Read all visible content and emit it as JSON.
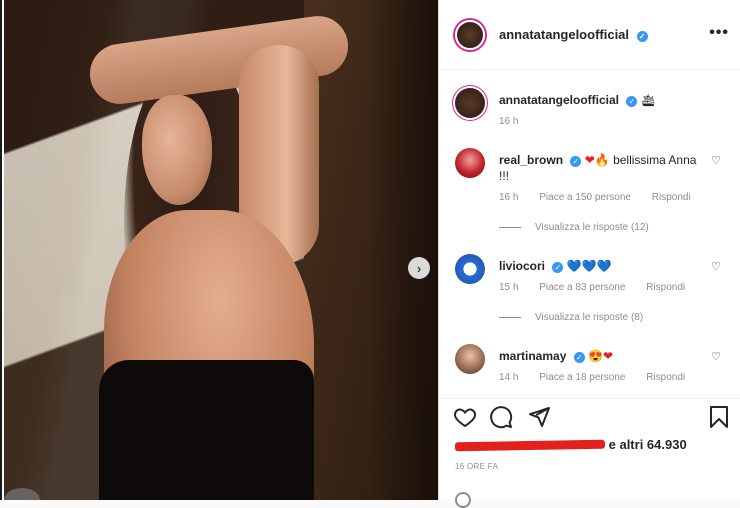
{
  "post": {
    "username": "annatatangeloofficial",
    "more_label": "•••"
  },
  "caption": {
    "username": "annatatangeloofficial",
    "emoji": "🛳",
    "time": "16 h"
  },
  "comments": [
    {
      "username": "real_brown",
      "text_emoji": "❤🔥",
      "text": "bellissima Anna !!!",
      "time": "16 h",
      "likes": "Piace a 150 persone",
      "reply": "Rispondi",
      "view_replies": "Visualizza le risposte (12)"
    },
    {
      "username": "liviocori",
      "text_emoji": "💙💙💙",
      "text": "",
      "time": "15 h",
      "likes": "Piace a 83 persone",
      "reply": "Rispondi",
      "view_replies": "Visualizza le risposte (8)"
    },
    {
      "username": "martinamay",
      "text_emoji": "😍❤",
      "text": "",
      "time": "14 h",
      "likes": "Piace a 18 persone",
      "reply": "Rispondi"
    }
  ],
  "footer": {
    "likes_suffix": "e altri 64.930",
    "timestamp": "16 ORE FA"
  },
  "icons": {
    "like": "heart-icon",
    "comment": "comment-icon",
    "share": "share-icon",
    "save": "bookmark-icon",
    "next": "chevron-right-icon",
    "more": "more-icon",
    "verified": "verified-badge-icon"
  },
  "colors": {
    "verified": "#3897f0",
    "story_ring": "#d6249f",
    "redaction": "#e2211c"
  }
}
